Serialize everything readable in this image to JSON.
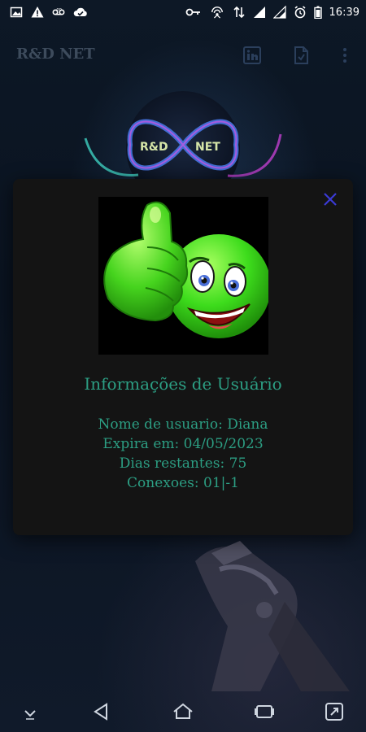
{
  "status_bar": {
    "time": "16:39",
    "left_icons": [
      "image-icon",
      "warning-icon",
      "voicemail-icon",
      "cloud-check-icon"
    ],
    "right_icons": [
      "key-icon",
      "hotspot-icon",
      "data-arrows-icon",
      "signal-icon",
      "signal-icon",
      "alarm-icon",
      "battery-icon"
    ]
  },
  "app_bar": {
    "title": "R&D NET",
    "actions": [
      "linkedin-icon",
      "document-icon",
      "more-vert-icon"
    ]
  },
  "logo": {
    "left_text": "R&D",
    "right_text": "NET"
  },
  "dialog": {
    "close_icon": "close-icon",
    "image": "thumbs-up-smiley",
    "title": "Informações de Usuário",
    "lines": [
      "Nome de usuario: Diana",
      "Expira em: 04/05/2023",
      "Dias restantes: 75",
      "Conexoes: 01|-1"
    ]
  },
  "nav_bar": [
    "hide-keyboard-icon",
    "back-icon",
    "home-icon",
    "recents-icon",
    "screenshot-icon"
  ],
  "colors": {
    "dialog_bg": "#141414",
    "accent_text": "#2c9e83",
    "close_icon": "#3b3bd6",
    "screen_bg": "#0b1422"
  }
}
